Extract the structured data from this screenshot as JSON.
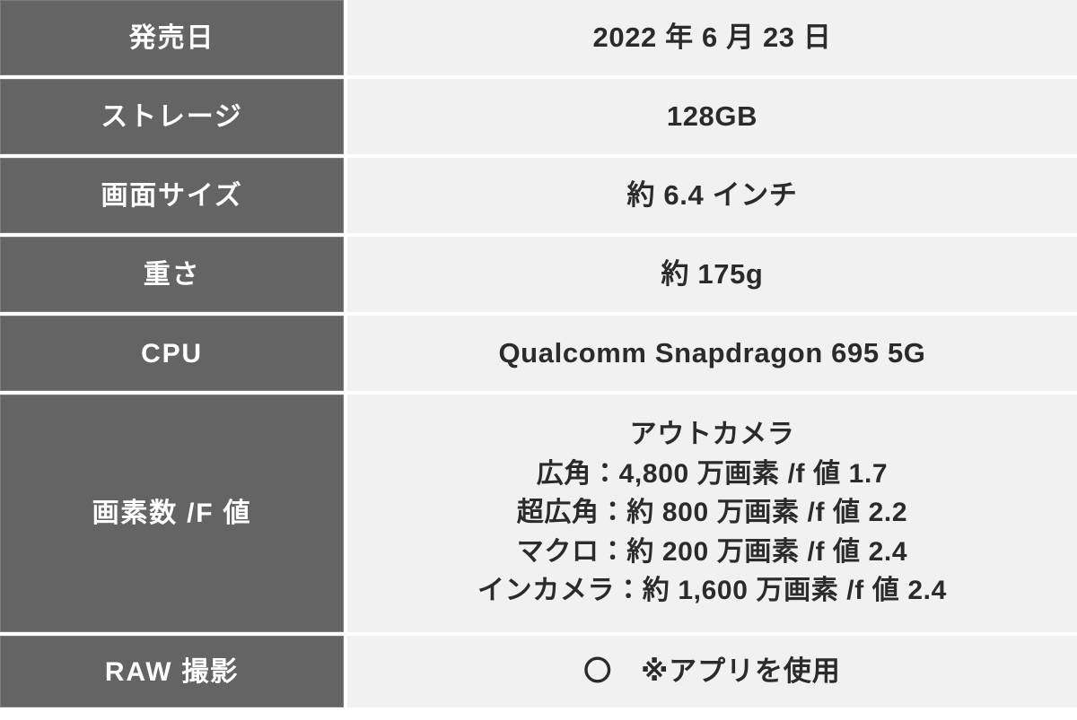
{
  "table": {
    "type": "spec-table",
    "colors": {
      "label_background": "#646464",
      "label_text": "#ffffff",
      "value_background": "#f1f1f1",
      "value_text": "#2b2b2b",
      "page_background": "#ffffff"
    },
    "rows": [
      {
        "label": "発売日",
        "value": "2022 年 6 月 23 日"
      },
      {
        "label": "ストレージ",
        "value": "128GB"
      },
      {
        "label": "画面サイズ",
        "value": "約 6.4 インチ"
      },
      {
        "label": "重さ",
        "value": "約 175g"
      },
      {
        "label": "CPU",
        "value": "Qualcomm Snapdragon 695 5G"
      },
      {
        "label": "画素数 /F 値",
        "value_lines": [
          "アウトカメラ",
          "広角：4,800 万画素 /f 値 1.7",
          "超広角：約 800 万画素 /f 値 2.2",
          "マクロ：約 200 万画素 /f 値 2.4",
          "インカメラ：約 1,600 万画素 /f 値 2.4"
        ]
      },
      {
        "label": "RAW 撮影",
        "value": "〇　※アプリを使用"
      }
    ]
  }
}
